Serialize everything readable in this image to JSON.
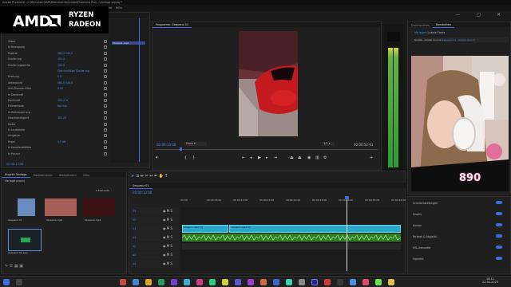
{
  "window": {
    "title": "Adobe Premiere - C:\\Benutzer\\IAM\\Dokumente\\Adobe\\Premiere Pro\\...\\Vorlage.prproj *",
    "controls": "— ▢ ✕"
  },
  "menu": [
    "Datei",
    "Bearbeiten",
    "Clip",
    "Sequenz",
    "Markierung",
    "Grafiken",
    "Ansicht",
    "Fenster",
    "Hilfe"
  ],
  "logo": {
    "brand": "AMD",
    "line1": "RYZEN",
    "line2": "RADEON"
  },
  "effect_controls": {
    "header": "Quelle: Stream1.mp4 ▸ Sequenz 01",
    "mini_clip": "Stream1.mp4",
    "rows": [
      {
        "label": "Video",
        "value": ""
      },
      {
        "label": "fx  Bewegung",
        "value": ""
      },
      {
        "label": "Position",
        "value": "960,0    540,0"
      },
      {
        "label": "Skalierung",
        "value": "100,0"
      },
      {
        "label": "Skalierungsbreite",
        "value": "100,0"
      },
      {
        "label": "",
        "value": "Gleichmäßige Skalierung"
      },
      {
        "label": "Drehung",
        "value": "0,0"
      },
      {
        "label": "Ankerpunkt",
        "value": "960,0    540,0"
      },
      {
        "label": "Anti-Flimmer-Filter",
        "value": "0,00"
      },
      {
        "label": "fx  Deckkraft",
        "value": ""
      },
      {
        "label": "Deckkraft",
        "value": "100,0 %"
      },
      {
        "label": "Füllmethode",
        "value": "Normal"
      },
      {
        "label": "fx  Zeitverzerrung",
        "value": ""
      },
      {
        "label": "Geschwindigkeit",
        "value": "100,00"
      },
      {
        "label": "Audio",
        "value": ""
      },
      {
        "label": "fx  Lautstärke",
        "value": ""
      },
      {
        "label": "Umgehen",
        "value": ""
      },
      {
        "label": "Pegel",
        "value": "0,0 dB"
      },
      {
        "label": "fx  Kanallautstärke",
        "value": ""
      },
      {
        "label": "fx  Panner",
        "value": ""
      }
    ],
    "timecode": "00:00:13:08"
  },
  "program": {
    "tab": "Programm: Sequenz 01",
    "timecode_left": "00:00:13:08",
    "fit": "Ganz",
    "quality": "1/2",
    "timecode_right": "00:00:52:01"
  },
  "essential_graphics": {
    "tabs": [
      "Durchsuchen",
      "Bearbeiten"
    ],
    "section": "Lokale Fonts",
    "subtabs": [
      "Vorlagen",
      "Meine Vorlagen"
    ],
    "items": [
      "Quelle - Global Source",
      "Sequenz 01 - Global Source"
    ],
    "overlay_count": "890"
  },
  "project": {
    "tabs": [
      "Projekt: Vorlage",
      "Mediabrowser",
      "Bibliotheken",
      "Infos"
    ],
    "path": "Vorlage.prproj",
    "count": "5 Elemente",
    "bins": [
      {
        "name": "Sequenz 01",
        "dur": "52:01"
      },
      {
        "name": "Stream1.mp4",
        "dur": "1:03:24"
      },
      {
        "name": "Stream2.mp4",
        "dur": "7:52"
      },
      {
        "name": "Audio.wav",
        "dur": "1:03:24"
      }
    ],
    "audio_bin": "Sequenz 01.wav"
  },
  "timeline": {
    "tab": "Sequenz 01",
    "timecode": "00:00:13:08",
    "ruler": [
      "00:00",
      "00:00:05:00",
      "00:00:10:00",
      "00:00:15:00",
      "00:00:20:00",
      "00:00:25:00",
      "00:00:30:00",
      "00:00:35:00",
      "00:00:40:00"
    ],
    "tracks": [
      "V3",
      "V2",
      "V1",
      "A1",
      "A2",
      "A3",
      "A4"
    ],
    "clips": [
      {
        "label": "Stream1.mp4 [V]",
        "track": "V1"
      },
      {
        "label": "Stream1.mp4 [V]",
        "track": "V1"
      },
      {
        "label": "Stream1.mp4 [A]",
        "track": "A1"
      }
    ]
  },
  "audio_meters": {
    "labels": [
      "-6",
      "-12",
      "-18",
      "-24",
      "-30",
      "-36",
      "-42",
      "-48",
      "-54",
      "dB"
    ]
  },
  "right_panel": {
    "rows": [
      "Grundeinstellungen",
      "Kreativ",
      "Kurven",
      "Farbrad & Abgleich",
      "HSL-Sekundär",
      "Vignette"
    ]
  },
  "clock": {
    "time": "18:11",
    "date": "22.04.2023"
  },
  "colors": {
    "accent": "#3b6de0",
    "clip_video": "#2aa8c9",
    "clip_audio": "#2f7f2a",
    "playhead": "#e0e0e0",
    "brand_red": "#c0161a"
  }
}
